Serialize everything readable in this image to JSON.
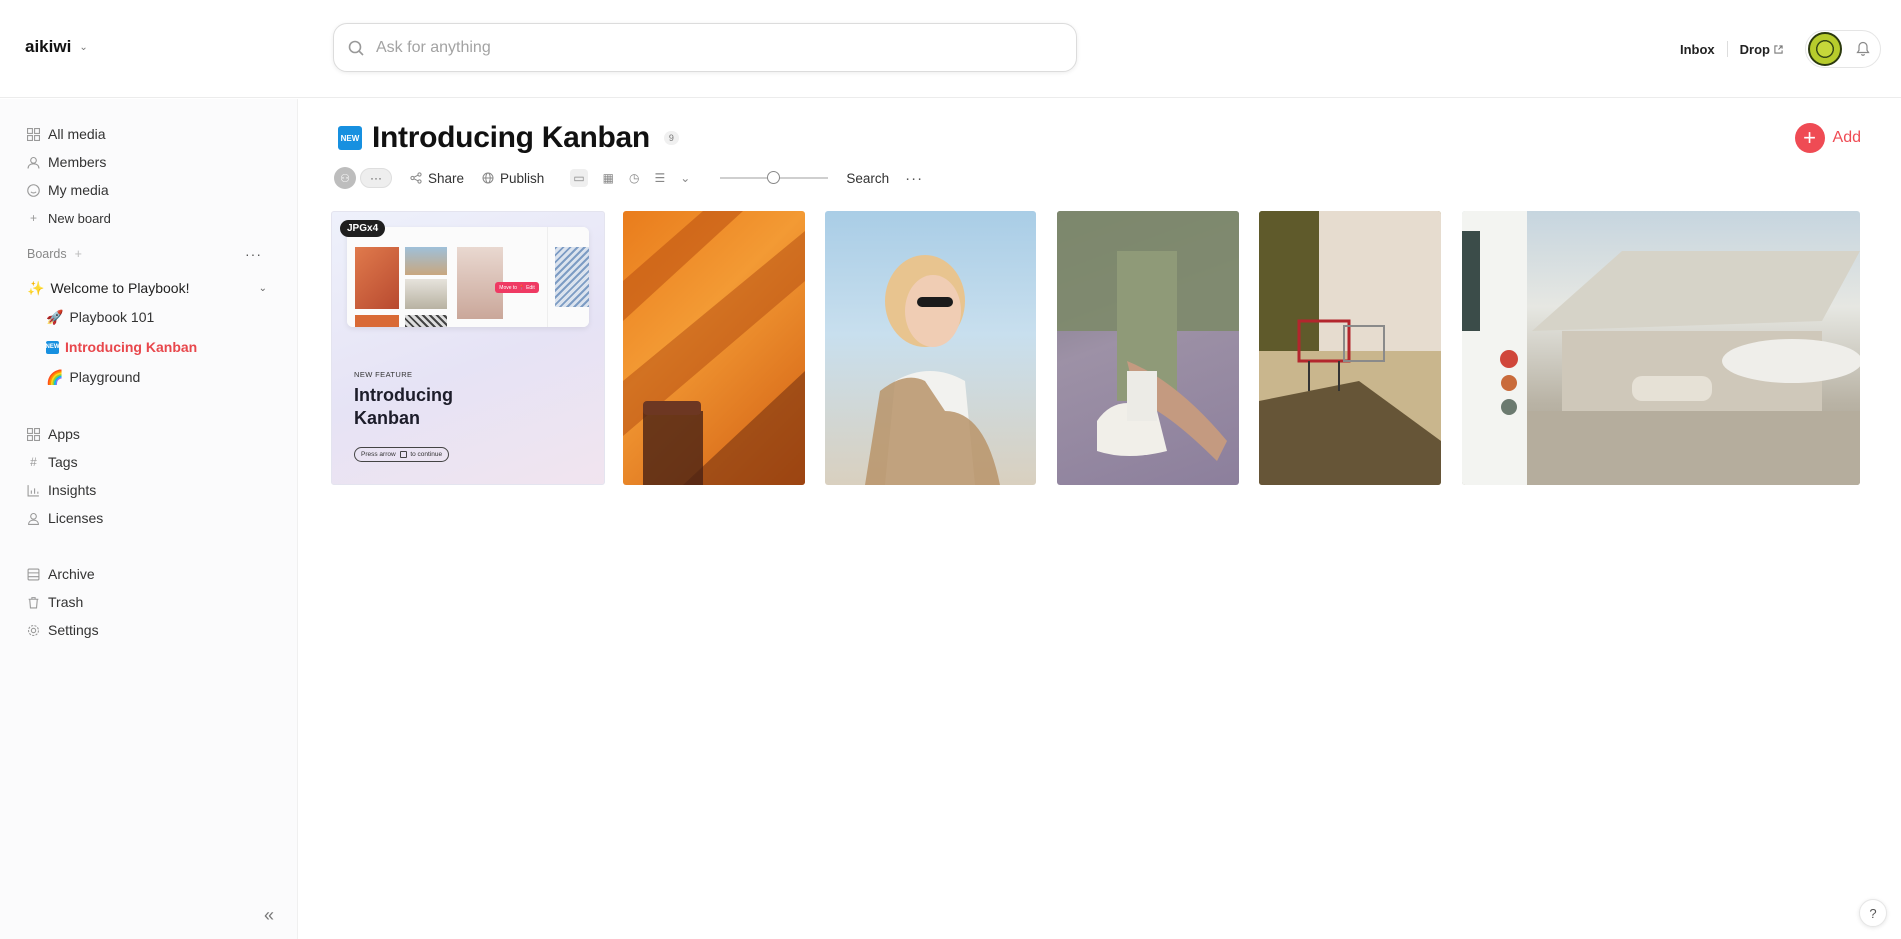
{
  "workspace": {
    "name": "aikiwi"
  },
  "search": {
    "placeholder": "Ask for anything"
  },
  "header": {
    "inbox_label": "Inbox",
    "drop_label": "Drop"
  },
  "sidebar": {
    "nav_top": [
      {
        "label": "All media",
        "icon": "grid-icon"
      },
      {
        "label": "Members",
        "icon": "person-icon"
      },
      {
        "label": "My media",
        "icon": "smiley-icon"
      },
      {
        "label": "New board",
        "icon": "plus-icon"
      }
    ],
    "boards_label": "Boards",
    "boards": {
      "root": {
        "label": "Welcome to Playbook!",
        "emoji": "✨"
      },
      "children": [
        {
          "label": "Playbook 101",
          "emoji": "🚀"
        },
        {
          "label": "Introducing Kanban",
          "emoji": "NEW",
          "active": true
        },
        {
          "label": "Playground",
          "emoji": "🌈"
        }
      ]
    },
    "nav_mid": [
      {
        "label": "Apps",
        "icon": "apps-icon"
      },
      {
        "label": "Tags",
        "icon": "hash-icon"
      },
      {
        "label": "Insights",
        "icon": "chart-icon"
      },
      {
        "label": "Licenses",
        "icon": "license-icon"
      }
    ],
    "nav_bottom": [
      {
        "label": "Archive",
        "icon": "archive-icon"
      },
      {
        "label": "Trash",
        "icon": "trash-icon"
      },
      {
        "label": "Settings",
        "icon": "gear-icon"
      }
    ]
  },
  "page": {
    "badge": "NEW",
    "title": "Introducing Kanban",
    "count": "9",
    "add_label": "Add"
  },
  "toolbar": {
    "more": "···",
    "share": "Share",
    "publish": "Publish",
    "search": "Search",
    "dots": "···",
    "zoom_level": 0.5
  },
  "cards": {
    "feature": {
      "tag": "JPGx4",
      "eyebrow": "NEW FEATURE",
      "headline": "Introducing Kanban",
      "cta_before": "Press arrow",
      "cta_after": "to continue",
      "pill": "Move to 📍 Edit"
    }
  },
  "colors": {
    "accent": "#ef4b54",
    "active_board": "#e8474c",
    "new_badge": "#1790e0"
  },
  "help": "?"
}
